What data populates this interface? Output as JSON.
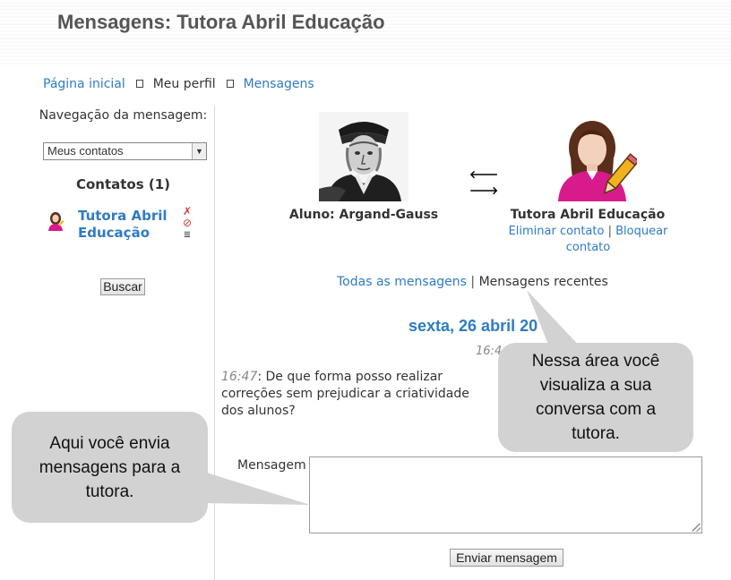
{
  "header": {
    "title": "Mensagens: Tutora Abril Educação"
  },
  "breadcrumb": {
    "home": "Página inicial",
    "profile": "Meu perfil",
    "messages": "Mensagens"
  },
  "sidebar": {
    "nav_label": "Navegação da mensagem:",
    "nav_selected": "Meus contatos",
    "contacts_heading": "Contatos (1)",
    "contact_name": "Tutora Abril Educação",
    "search_label": "Buscar"
  },
  "conversation": {
    "student_label": "Aluno: Argand-Gauss",
    "tutor_label": "Tutora Abril Educação",
    "remove_contact": "Eliminar contato",
    "separator": "|",
    "block_contact": "Bloquear contato",
    "tab_all": "Todas as mensagens",
    "tab_recent": "Mensagens recentes",
    "date_heading": "sexta, 26 abril 20",
    "time_partial": "16:4",
    "message_time": "16:47",
    "message_text": ": De que forma posso realizar correções sem prejudicar a criatividade dos alunos?",
    "compose_label": "Mensagem",
    "send_label": "Enviar mensagem"
  },
  "callouts": {
    "conversation_area": "Nessa área você visualiza a sua conversa com a tutora.",
    "send_area": "Aqui você envia mensagens para a tutora."
  },
  "colors": {
    "link": "#2e7bc4",
    "callout_bg": "#d2d2d2",
    "tutor_shirt": "#d81b8c"
  }
}
